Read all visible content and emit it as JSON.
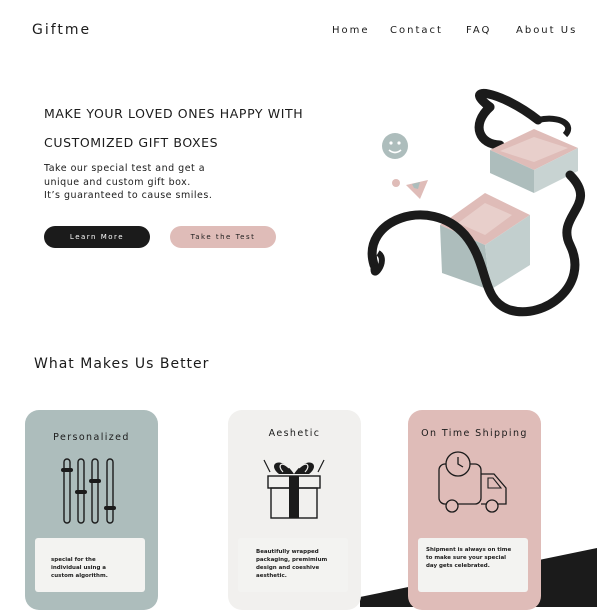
{
  "brand": {
    "logo": "Giftme"
  },
  "nav": {
    "home": "Home",
    "contact": "Contact",
    "faq": "FAQ",
    "about": "About Us"
  },
  "hero": {
    "title_line1": "MAKE YOUR LOVED ONES HAPPY WITH",
    "title_line2": "CUSTOMIZED GIFT BOXES",
    "text_line1": "Take our special test and get a",
    "text_line2": "unique and custom gift box.",
    "text_line3": "It’s guaranteed to cause smiles.",
    "learn_more": "Learn More",
    "take_test": "Take the Test"
  },
  "features": {
    "title": "What Makes Us Better",
    "cards": [
      {
        "title": "Personalized",
        "desc_lines": [
          "special for the",
          "individual using a",
          "custom algorithm."
        ],
        "color": "#adbdbc",
        "icon": "sliders-icon"
      },
      {
        "title": "Aeshetic",
        "desc_lines": [
          "Beautifully wrapped",
          "packaging, premimium",
          "design and coeshive",
          "aesthetic."
        ],
        "color": "#f1f0ee",
        "icon": "gift-icon"
      },
      {
        "title": "On Time Shipping",
        "desc_lines": [
          "Shipment is always on time",
          "to make sure your special",
          "day gets celebrated."
        ],
        "color": "#dfbcb8",
        "icon": "delivery-truck-clock-icon"
      }
    ]
  },
  "colors": {
    "dark": "#1b1b1b",
    "teal": "#adbdbc",
    "pink": "#dfbcb8",
    "light": "#f1f0ee"
  }
}
